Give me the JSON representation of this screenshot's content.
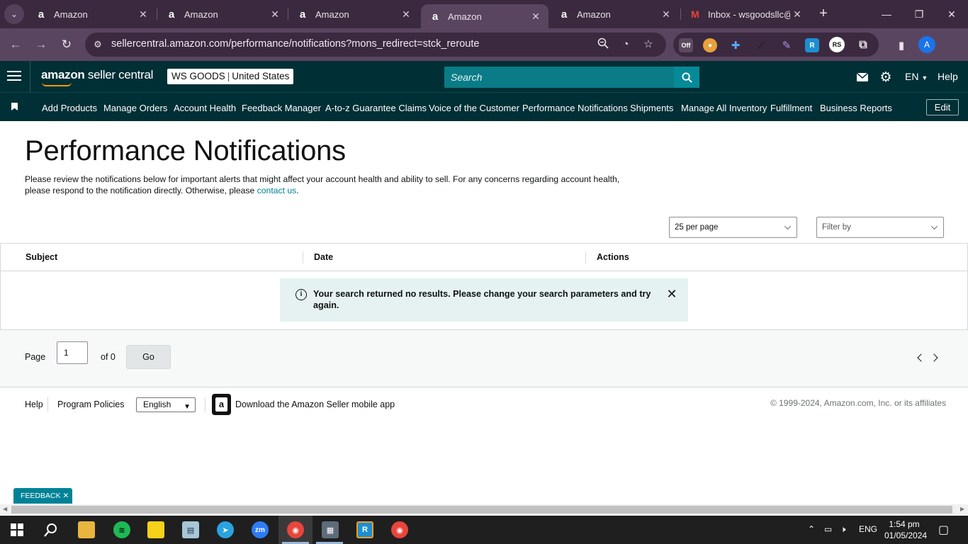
{
  "browser": {
    "tabs": [
      {
        "title": "Amazon",
        "favicon": "amazon-a",
        "active": false
      },
      {
        "title": "Amazon",
        "favicon": "amazon-a",
        "active": false
      },
      {
        "title": "Amazon",
        "favicon": "amazon-a",
        "active": false
      },
      {
        "title": "Amazon",
        "favicon": "amazon-a",
        "active": true
      },
      {
        "title": "Amazon",
        "favicon": "amazon-a",
        "active": false
      },
      {
        "title": "Inbox - wsgoodsllc@",
        "favicon": "gmail-m",
        "active": false
      }
    ],
    "url": "sellercentral.amazon.com/performance/notifications?mons_redirect=stck_reroute",
    "extension_badge": "Off",
    "profile_initial": "A"
  },
  "header": {
    "logo_bold": "amazon",
    "logo_rest": " seller central",
    "store_name": "WS GOODS",
    "store_region": "United States",
    "search_placeholder": "Search",
    "language": "EN",
    "help": "Help"
  },
  "nav": {
    "items": [
      "Add Products",
      "Manage Orders",
      "Account Health",
      "Feedback Manager",
      "A-to-z Guarantee Claims",
      "Voice of the Customer",
      "Performance Notifications",
      "Shipments",
      "Manage All Inventory",
      "Fulfillment",
      "Business Reports"
    ],
    "edit": "Edit"
  },
  "page": {
    "title": "Performance Notifications",
    "intro": "Please review the notifications below for important alerts that might affect your account health and ability to sell. For any concerns regarding account health, please respond to the notification directly. Otherwise, please ",
    "contact_link": "contact us",
    "intro_end": ".",
    "per_page": "25 per page",
    "filter_placeholder": "Filter by"
  },
  "table": {
    "columns": [
      "Subject",
      "Date",
      "Actions"
    ],
    "empty_message": "Your search returned no results. Please change your search parameters and try again."
  },
  "pagination": {
    "page_label": "Page",
    "current_page": "1",
    "of_label": "of 0",
    "go": "Go"
  },
  "footer": {
    "help": "Help",
    "program_policies": "Program Policies",
    "language": "English",
    "download_app": "Download the Amazon Seller mobile app",
    "copyright": "© 1999-2024, Amazon.com, Inc. or its affiliates"
  },
  "feedback": "FEEDBACK",
  "taskbar": {
    "lang": "ENG",
    "time": "1:54 pm",
    "date": "01/05/2024"
  },
  "colors": {
    "header_bg": "#002f36",
    "search_bg": "#0a7c87",
    "link": "#008296",
    "alert_bg": "#e6f2f2",
    "chrome_frame": "#3b2a3f"
  }
}
